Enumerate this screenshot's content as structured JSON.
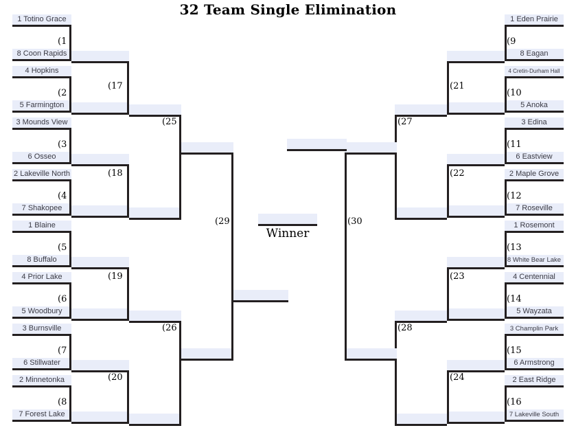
{
  "title": "32 Team Single Elimination",
  "winner_label": "Winner",
  "colors": {
    "slot_background": "#e9edf9",
    "line": "#231f20",
    "label_text": "#3a3a44",
    "page_background": "#ffffff"
  },
  "regions": {
    "top_left": {
      "round1": [
        {
          "game": "(1",
          "teams": [
            "1 Totino Grace",
            "8 Coon Rapids"
          ]
        },
        {
          "game": "(2",
          "teams": [
            "4 Hopkins",
            "5 Farmington"
          ]
        },
        {
          "game": "(3",
          "teams": [
            "3 Mounds View",
            "6 Osseo"
          ]
        },
        {
          "game": "(4",
          "teams": [
            "2 Lakeville North",
            "7 Shakopee"
          ]
        }
      ],
      "round2": [
        {
          "game": "(17"
        },
        {
          "game": "(18"
        }
      ],
      "round3": [
        {
          "game": "(25"
        }
      ]
    },
    "bottom_left": {
      "round1": [
        {
          "game": "(5",
          "teams": [
            "1 Blaine",
            "8 Buffalo"
          ]
        },
        {
          "game": "(6",
          "teams": [
            "4 Prior Lake",
            "5 Woodbury"
          ]
        },
        {
          "game": "(7",
          "teams": [
            "3 Burnsville",
            "6 Stillwater"
          ]
        },
        {
          "game": "(8",
          "teams": [
            "2 Minnetonka",
            "7 Forest Lake"
          ]
        }
      ],
      "round2": [
        {
          "game": "(19"
        },
        {
          "game": "(20"
        }
      ],
      "round3": [
        {
          "game": "(26"
        }
      ]
    },
    "top_right": {
      "round1": [
        {
          "game": "(9",
          "teams": [
            "1 Eden Prairie",
            "8 Eagan"
          ]
        },
        {
          "game": "(10",
          "teams": [
            "4 Cretin-Durham Hall",
            "5 Anoka"
          ]
        },
        {
          "game": "(11",
          "teams": [
            "3 Edina",
            "6 Eastview"
          ]
        },
        {
          "game": "(12",
          "teams": [
            "2 Maple Grove",
            "7 Roseville"
          ]
        }
      ],
      "round2": [
        {
          "game": "(21"
        },
        {
          "game": "(22"
        }
      ],
      "round3": [
        {
          "game": "(27"
        }
      ]
    },
    "bottom_right": {
      "round1": [
        {
          "game": "(13",
          "teams": [
            "1 Rosemont",
            "8 White Bear Lake"
          ]
        },
        {
          "game": "(14",
          "teams": [
            "4 Centennial",
            "5 Wayzata"
          ]
        },
        {
          "game": "(15",
          "teams": [
            "3 Champlin Park",
            "6 Armstrong"
          ]
        },
        {
          "game": "(16",
          "teams": [
            "2 East Ridge",
            "7 Lakeville South"
          ]
        }
      ],
      "round2": [
        {
          "game": "(23"
        },
        {
          "game": "(24"
        }
      ],
      "round3": [
        {
          "game": "(28"
        }
      ]
    },
    "semifinals": {
      "left": {
        "game": "(29"
      },
      "right": {
        "game": "(30"
      }
    }
  }
}
